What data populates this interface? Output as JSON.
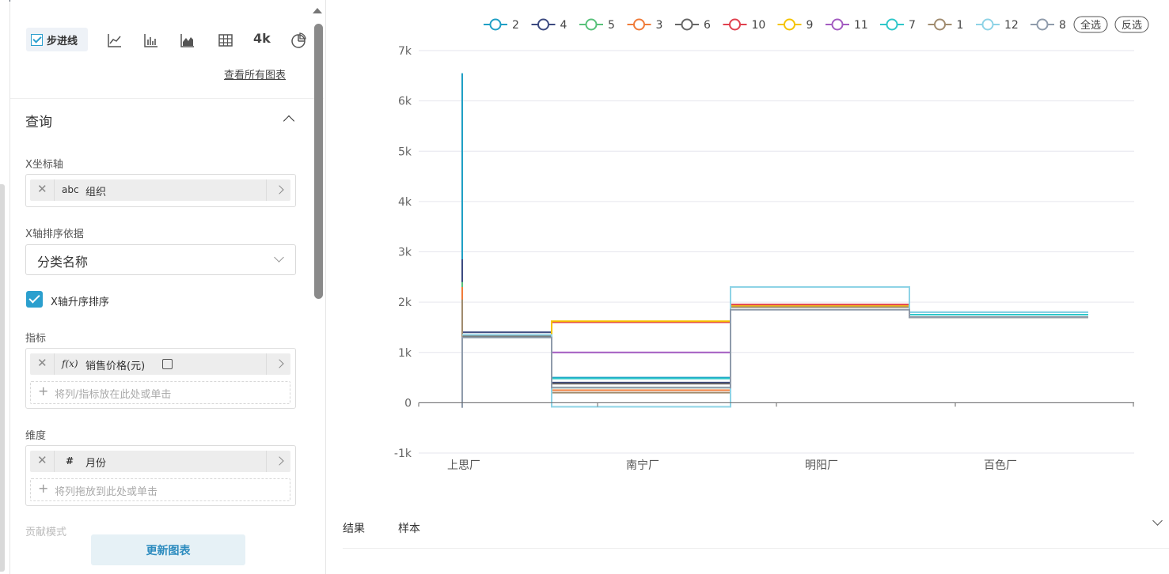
{
  "toolbar": {
    "step_line_label": "步进线",
    "kpi_4k_label": "4k",
    "icons": [
      "line-chart-icon",
      "bar-chart-icon",
      "area-chart-icon",
      "table-icon",
      "pie-chart-icon"
    ],
    "view_all_charts": "查看所有图表"
  },
  "query": {
    "title": "查询",
    "x_axis": {
      "label": "X坐标轴",
      "type": "abc",
      "field": "组织"
    },
    "x_sort": {
      "label": "X轴排序依据",
      "value": "分类名称"
    },
    "x_asc": {
      "label": "X轴升序排序",
      "checked": true
    },
    "metrics": {
      "label": "指标",
      "type": "f(x)",
      "field": "销售价格(元)",
      "drop_hint": "将列/指标放在此处或单击"
    },
    "dimension": {
      "label": "维度",
      "type": "#",
      "field": "月份",
      "drop_hint": "将列拖放到此处或单击"
    },
    "contribution_mode": "贡献模式",
    "update_button": "更新图表"
  },
  "legend": {
    "select_all": "全选",
    "invert": "反选"
  },
  "results": {
    "tab1": "结果",
    "tab2": "样本"
  },
  "chart_data": {
    "type": "line",
    "subtype": "step",
    "categories": [
      "上思厂",
      "南宁厂",
      "明阳厂",
      "百色厂"
    ],
    "ylim": [
      -1000,
      7000
    ],
    "yticks": [
      -1000,
      0,
      1000,
      2000,
      3000,
      4000,
      5000,
      6000,
      7000
    ],
    "ytick_labels": [
      "-1k",
      "0",
      "1k",
      "2k",
      "3k",
      "4k",
      "5k",
      "6k",
      "7k"
    ],
    "grid": true,
    "legend_position": "top-right",
    "series": [
      {
        "name": "2",
        "color": "#1f9fc5",
        "values": [
          1300,
          500,
          1900,
          1800
        ]
      },
      {
        "name": "4",
        "color": "#3c4a80",
        "values": [
          1400,
          400,
          1900,
          1700
        ]
      },
      {
        "name": "5",
        "color": "#58c17a",
        "values": [
          1330,
          300,
          1900,
          1700
        ]
      },
      {
        "name": "3",
        "color": "#f07b39",
        "values": [
          1350,
          250,
          1950,
          1750
        ]
      },
      {
        "name": "6",
        "color": "#666666",
        "values": [
          1330,
          380,
          1900,
          1700
        ]
      },
      {
        "name": "10",
        "color": "#e0404e",
        "values": [
          1350,
          1600,
          1950,
          1750
        ]
      },
      {
        "name": "9",
        "color": "#f5c400",
        "values": [
          1350,
          1620,
          1920,
          1750
        ]
      },
      {
        "name": "11",
        "color": "#a35bc1",
        "values": [
          1350,
          1000,
          1900,
          1750
        ]
      },
      {
        "name": "7",
        "color": "#2ec7c9",
        "values": [
          1350,
          480,
          1900,
          1750
        ]
      },
      {
        "name": "1",
        "color": "#a08b6e",
        "values": [
          1300,
          200,
          1900,
          1700
        ]
      },
      {
        "name": "12",
        "color": "#8ed3e6",
        "values": [
          1350,
          -80,
          2300,
          1800
        ]
      },
      {
        "name": "8",
        "color": "#8f9bab",
        "values": [
          1300,
          300,
          1850,
          1700
        ]
      }
    ],
    "first_spike_tops": {
      "2": 6550,
      "4": 2850,
      "5": 2400,
      "3": 2300,
      "1": 2050,
      "8": -100
    }
  }
}
